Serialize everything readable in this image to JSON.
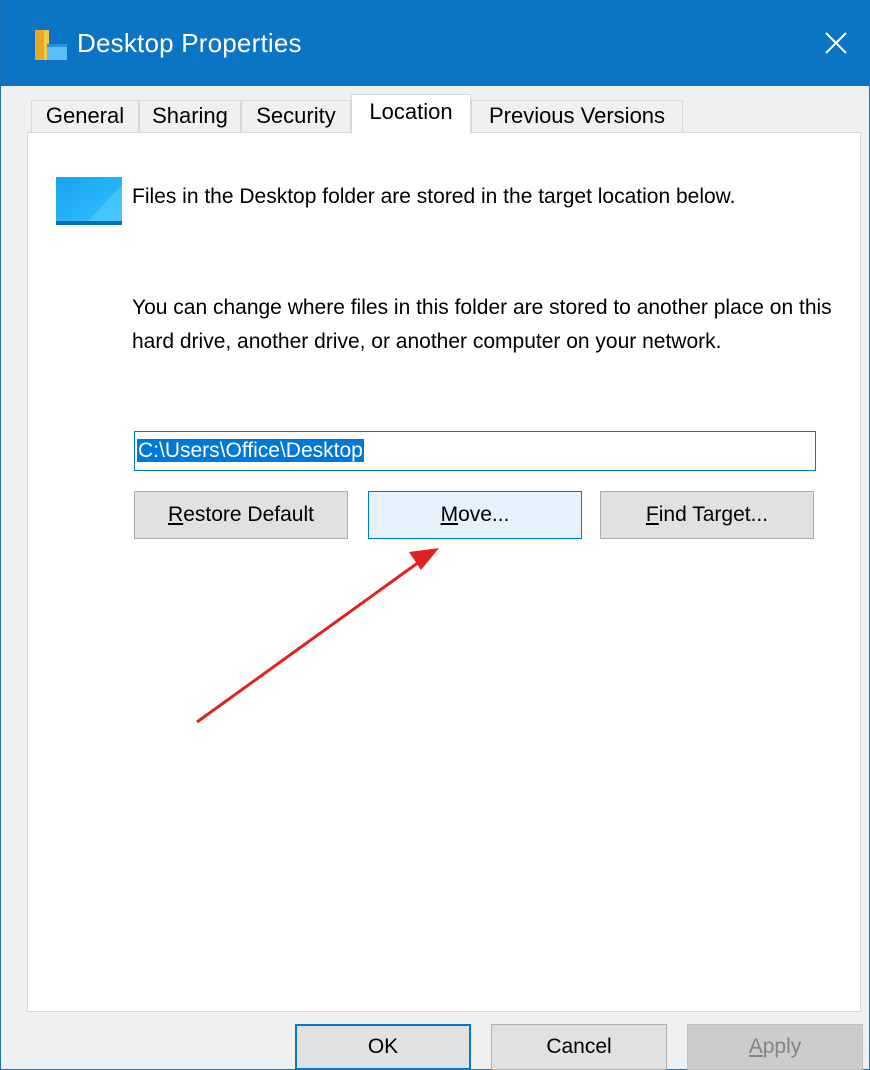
{
  "window": {
    "title": "Desktop Properties",
    "accent_color": "#0b74c4"
  },
  "tabs": [
    {
      "label": "General"
    },
    {
      "label": "Sharing"
    },
    {
      "label": "Security"
    },
    {
      "label": "Location",
      "active": true
    },
    {
      "label": "Previous Versions"
    }
  ],
  "location": {
    "description": "Files in the Desktop folder are stored in the target location below.",
    "instructions": "You can change where files in this folder are stored to another place on this hard drive, another drive, or another computer on your network.",
    "path_value": "C:\\Users\\Office\\Desktop",
    "restore_default": {
      "accel": "R",
      "rest": "estore Default"
    },
    "move": {
      "accel": "M",
      "rest": "ove..."
    },
    "find_target": {
      "accel": "F",
      "rest": "ind Target..."
    }
  },
  "footer": {
    "ok_label": "OK",
    "cancel_label": "Cancel",
    "apply": {
      "accel": "A",
      "rest": "pply"
    }
  },
  "annotation": {
    "arrow_color": "#e32020"
  }
}
